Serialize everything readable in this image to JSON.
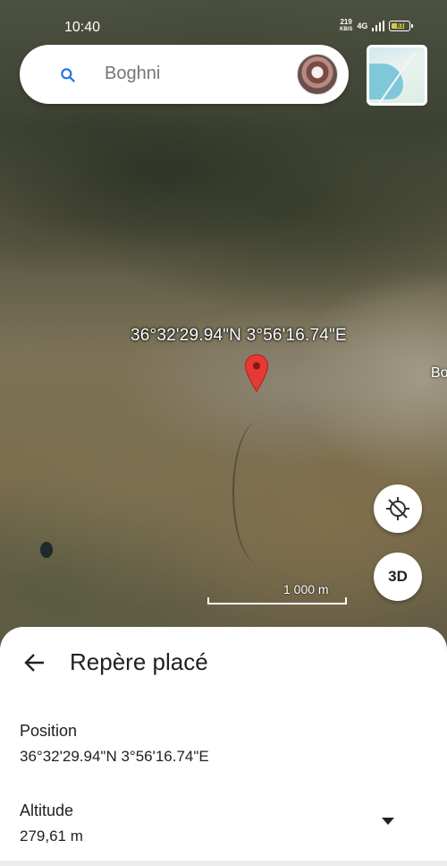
{
  "status_bar": {
    "time": "10:40",
    "net_speed_value": "219",
    "net_speed_unit": "KB/S",
    "network_type": "4G",
    "battery": "83"
  },
  "search": {
    "query": "Boghni"
  },
  "map": {
    "pin_coordinates": "36°32'29.94\"N 3°56'16.74\"E",
    "edge_label": "Bo",
    "scale_label": "1 000 m",
    "button_3d": "3D"
  },
  "sheet": {
    "title": "Repère placé",
    "position_label": "Position",
    "position_value": "36°32'29.94\"N 3°56'16.74\"E",
    "altitude_label": "Altitude",
    "altitude_value": "279,61 m"
  },
  "icons": {
    "search": "search-icon",
    "back": "arrow-left-icon",
    "location": "location-disabled-icon",
    "dropdown": "triangle-down-icon",
    "pin": "map-pin-icon"
  },
  "colors": {
    "search_icon": "#1a73e8",
    "pin": "#e53935"
  }
}
